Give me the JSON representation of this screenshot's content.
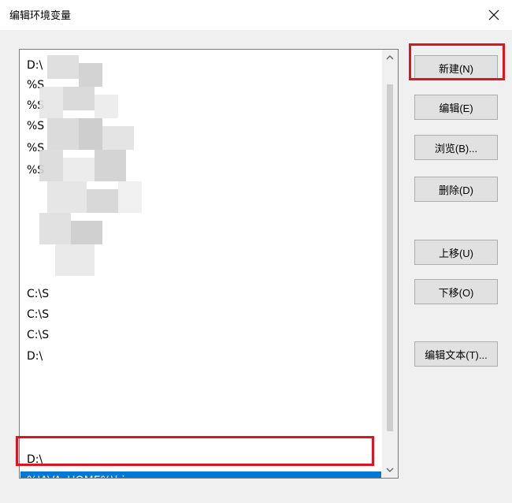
{
  "window": {
    "title": "编辑环境变量",
    "close_icon": "close-icon"
  },
  "list": {
    "items": [
      "D:\\",
      "%S",
      "%S",
      "%S",
      "%S",
      "%S",
      "",
      "",
      "",
      "",
      "",
      "C:\\S",
      "C:\\S",
      "C:\\S",
      "D:\\",
      "",
      "",
      "",
      "",
      "D:\\",
      "%JAVA_HOME%\\bin"
    ],
    "selected_index": 20
  },
  "buttons": {
    "new": "新建(N)",
    "edit": "编辑(E)",
    "browse": "浏览(B)...",
    "delete": "删除(D)",
    "move_up": "上移(U)",
    "move_down": "下移(O)",
    "edit_text": "编辑文本(T)..."
  },
  "colors": {
    "selection": "#0078d7",
    "highlight_border": "#e0141e",
    "button_bg": "#e1e1e1"
  }
}
